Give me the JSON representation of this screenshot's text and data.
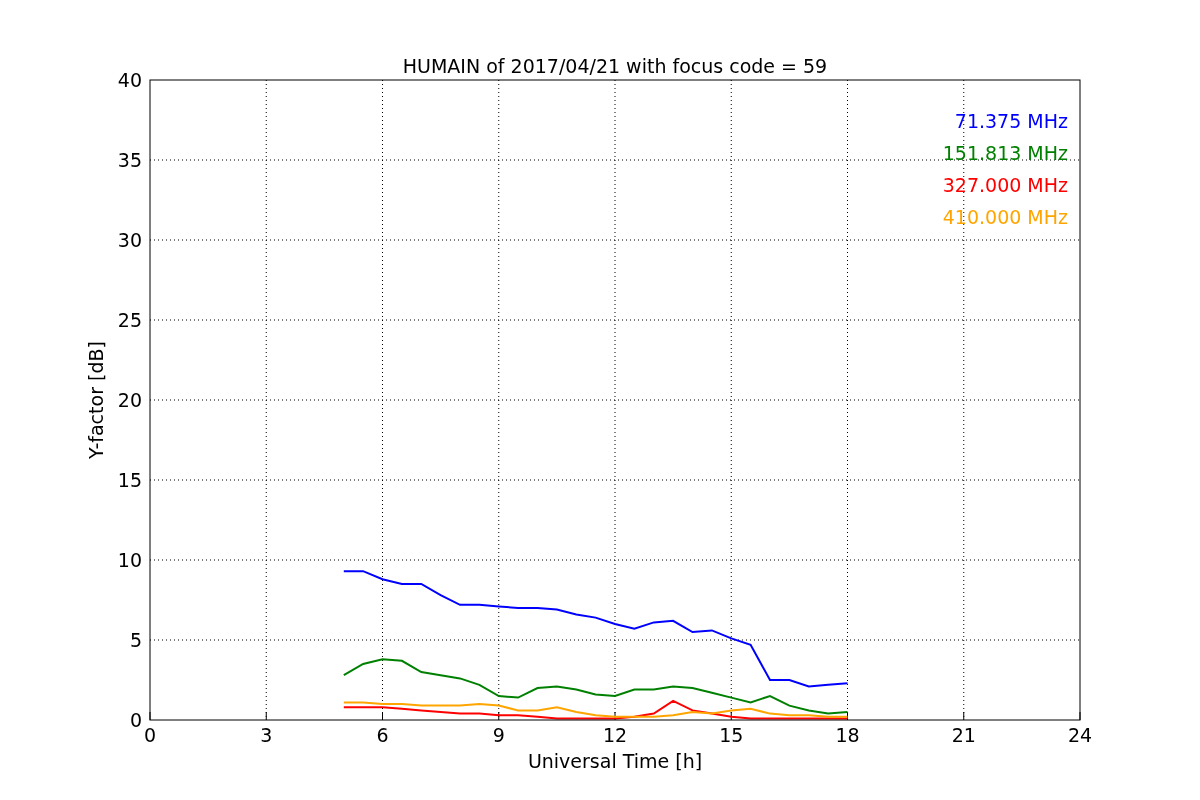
{
  "chart_data": {
    "type": "line",
    "title": "HUMAIN of 2017/04/21 with focus code = 59",
    "xlabel": "Universal Time [h]",
    "ylabel": "Y-factor [dB]",
    "x": [
      5,
      5.5,
      6,
      6.5,
      7,
      7.5,
      8,
      8.5,
      9,
      9.5,
      10,
      10.5,
      11,
      11.5,
      12,
      12.5,
      13,
      13.5,
      14,
      14.5,
      15,
      15.5,
      16,
      16.5,
      17,
      17.5,
      18
    ],
    "series": [
      {
        "name": "71.375 MHz",
        "color": "#0000ff",
        "values": [
          9.3,
          9.3,
          8.8,
          8.5,
          8.5,
          7.8,
          7.2,
          7.2,
          7.1,
          7.0,
          7.0,
          6.9,
          6.6,
          6.4,
          6.0,
          5.7,
          6.1,
          6.2,
          5.5,
          5.6,
          5.1,
          4.7,
          2.5,
          2.5,
          2.1,
          2.2,
          2.3
        ]
      },
      {
        "name": "151.813 MHz",
        "color": "#008000",
        "values": [
          2.8,
          3.5,
          3.8,
          3.7,
          3.0,
          2.8,
          2.6,
          2.2,
          1.5,
          1.4,
          2.0,
          2.1,
          1.9,
          1.6,
          1.5,
          1.9,
          1.9,
          2.1,
          2.0,
          1.7,
          1.4,
          1.1,
          1.5,
          0.9,
          0.6,
          0.4,
          0.5
        ]
      },
      {
        "name": "327.000 MHz",
        "color": "#ff0000",
        "values": [
          0.8,
          0.8,
          0.8,
          0.7,
          0.6,
          0.5,
          0.4,
          0.4,
          0.3,
          0.3,
          0.2,
          0.1,
          0.1,
          0.1,
          0.1,
          0.2,
          0.4,
          1.2,
          0.6,
          0.4,
          0.2,
          0.1,
          0.1,
          0.1,
          0.1,
          0.1,
          0.1
        ]
      },
      {
        "name": "410.000 MHz",
        "color": "#ffa500",
        "values": [
          1.1,
          1.1,
          1.0,
          1.0,
          0.9,
          0.9,
          0.9,
          1.0,
          0.9,
          0.6,
          0.6,
          0.8,
          0.5,
          0.3,
          0.2,
          0.2,
          0.2,
          0.3,
          0.5,
          0.4,
          0.6,
          0.7,
          0.4,
          0.3,
          0.3,
          0.2,
          0.2
        ]
      }
    ],
    "xlim": [
      0,
      24
    ],
    "ylim": [
      0,
      40
    ],
    "xticks": [
      0,
      3,
      6,
      9,
      12,
      15,
      18,
      21,
      24
    ],
    "yticks": [
      0,
      5,
      10,
      15,
      20,
      25,
      30,
      35,
      40
    ],
    "grid": true
  }
}
